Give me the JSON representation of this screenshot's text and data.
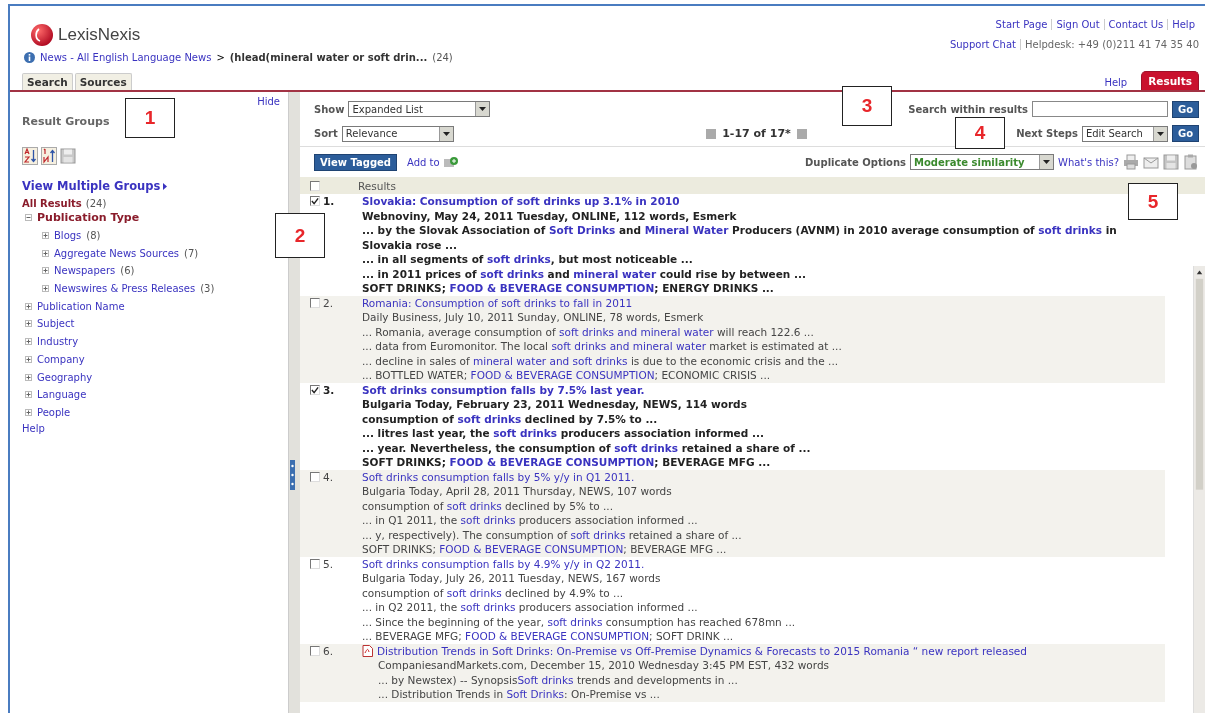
{
  "logo": {
    "name": "LexisNexis"
  },
  "top_links": [
    "Start Page",
    "Sign Out",
    "Contact Us",
    "Help"
  ],
  "support": {
    "link": "Support Chat",
    "helpdesk": "Helpdesk: +49 (0)211 41 74 35 40"
  },
  "breadcrumb": {
    "source": "News - All English Language News",
    "separator": ">",
    "query": "(hlead(mineral water or soft drin...",
    "count": "(24)"
  },
  "tabs": [
    {
      "label": "Search",
      "selected": false
    },
    {
      "label": "Sources",
      "selected": false
    }
  ],
  "right_tabs": [
    {
      "label": "Help",
      "selected": false
    },
    {
      "label": "Results",
      "selected": true
    }
  ],
  "sidebar": {
    "hide": "Hide",
    "title": "Result Groups",
    "view_multiple": "View Multiple Groups",
    "all_results": {
      "label": "All Results",
      "count": "(24)"
    },
    "groups": [
      {
        "label": "Publication Type",
        "expanded": true,
        "children": [
          {
            "label": "Blogs",
            "count": "(8)",
            "expanded": false
          },
          {
            "label": "Aggregate News Sources",
            "count": "(7)",
            "expanded": false
          },
          {
            "label": "Newspapers",
            "count": "(6)",
            "expanded": false
          },
          {
            "label": "Newswires & Press Releases",
            "count": "(3)",
            "expanded": false
          }
        ]
      },
      {
        "label": "Publication Name",
        "expanded": false
      },
      {
        "label": "Subject",
        "expanded": false
      },
      {
        "label": "Industry",
        "expanded": false
      },
      {
        "label": "Company",
        "expanded": false
      },
      {
        "label": "Geography",
        "expanded": false
      },
      {
        "label": "Language",
        "expanded": false
      },
      {
        "label": "People",
        "expanded": false
      }
    ],
    "help": "Help"
  },
  "toolbar": {
    "show": {
      "label": "Show",
      "value": "Expanded List"
    },
    "sort": {
      "label": "Sort",
      "value": "Relevance"
    },
    "range": "1-17 of 17*",
    "search_within": {
      "label": "Search within results",
      "button": "Go"
    },
    "next_steps": {
      "label": "Next Steps",
      "value": "Edit Search",
      "button": "Go"
    },
    "view_tagged": "View Tagged",
    "add_to": "Add to",
    "duplicate": {
      "label": "Duplicate Options",
      "value": "Moderate similarity"
    },
    "whats_this": "What's this?"
  },
  "results": {
    "header": "Results",
    "header_checked": false,
    "rows": [
      {
        "number": "1.",
        "checked": true,
        "kind": "article",
        "title": "Slovakia: Consumption of soft drinks up 3.1% in 2010",
        "lines": [
          "Webnoviny, May 24, 2011 Tuesday, ONLINE, 112 words, Esmerk",
          "... by the Slovak Association of **Soft Drinks** and **Mineral Water** Producers (AVNM) in 2010 average consumption of **soft drinks** in Slovakia rose ...",
          "... in all segments of **soft drinks**, but most noticeable ...",
          "... in 2011 prices of **soft drinks** and **mineral water** could rise by between ...",
          "SOFT DRINKS; **FOOD & BEVERAGE CONSUMPTION**; ENERGY DRINKS ..."
        ]
      },
      {
        "number": "2.",
        "checked": false,
        "kind": "article",
        "title": "Romania: Consumption of soft drinks to fall in 2011",
        "lines": [
          "Daily Business, July 10, 2011 Sunday, ONLINE, 78 words, Esmerk",
          "... Romania, average consumption of **soft drinks and mineral water** will reach 122.6 ...",
          "... data from Euromonitor. The local **soft drinks and mineral water** market is estimated at ...",
          "... decline in sales of **mineral water and soft drinks** is due to the economic crisis and the ...",
          "... BOTTLED WATER; **FOOD & BEVERAGE CONSUMPTION**; ECONOMIC CRISIS ..."
        ]
      },
      {
        "number": "3.",
        "checked": true,
        "kind": "article",
        "title": "Soft drinks consumption falls by 7.5% last year.",
        "lines": [
          "Bulgaria Today, February 23, 2011 Wednesday, NEWS, 114 words",
          "consumption of **soft drinks** declined by 7.5% to ...",
          "... litres last year, the **soft drinks** producers association informed ...",
          "... year. Nevertheless, the consumption of **soft drinks** retained a share of ...",
          "SOFT DRINKS; **FOOD & BEVERAGE CONSUMPTION**; BEVERAGE MFG ..."
        ]
      },
      {
        "number": "4.",
        "checked": false,
        "kind": "article",
        "title": "Soft drinks consumption falls by 5% y/y in Q1 2011.",
        "lines": [
          "Bulgaria Today, April 28, 2011 Thursday, NEWS, 107 words",
          "consumption of **soft drinks** declined by 5% to ...",
          "... in Q1 2011, the **soft drinks** producers association informed ...",
          "... y, respectively). The consumption of **soft drinks** retained a share of ...",
          "SOFT DRINKS; **FOOD & BEVERAGE CONSUMPTION**; BEVERAGE MFG ..."
        ]
      },
      {
        "number": "5.",
        "checked": false,
        "kind": "article",
        "title": "Soft drinks consumption falls by 4.9% y/y in Q2 2011.",
        "lines": [
          "Bulgaria Today, July 26, 2011 Tuesday, NEWS, 167 words",
          "consumption of **soft drinks** declined by 4.9% to ...",
          "... in Q2 2011, the **soft drinks** producers association informed ...",
          "... Since the beginning of the year, **soft drinks** consumption has reached 678mn ...",
          "... BEVERAGE MFG; **FOOD & BEVERAGE CONSUMPTION**; SOFT DRINK ..."
        ]
      },
      {
        "number": "6.",
        "checked": false,
        "kind": "pdf",
        "title": "Distribution Trends in Soft Drinks: On-Premise vs Off-Premise Dynamics & Forecasts to 2015 Romania “ new report released",
        "lines": [
          "CompaniesandMarkets.com, December 15, 2010 Wednesday 3:45 PM EST, 432 words",
          "... by Newstex) -- Synopsis**Soft drinks** trends and developments in ...",
          "... Distribution Trends in **Soft Drinks**: On-Premise vs ..."
        ]
      }
    ]
  },
  "callouts": [
    "1",
    "2",
    "3",
    "4",
    "5"
  ]
}
